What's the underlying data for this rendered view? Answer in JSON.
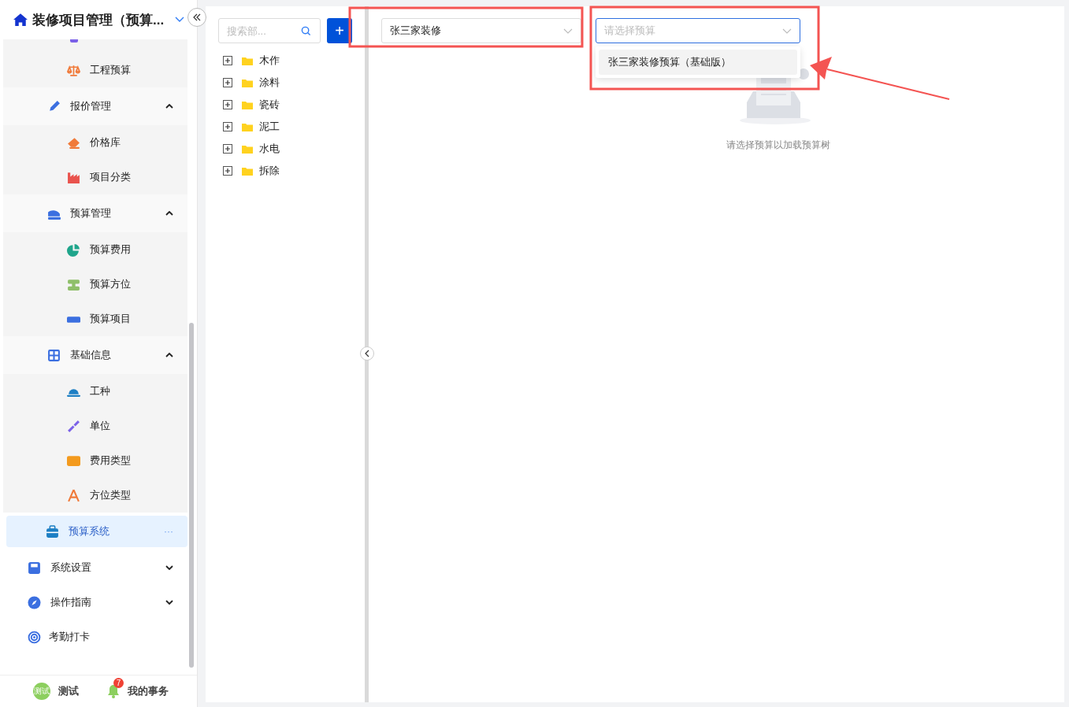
{
  "sidebar": {
    "title": "装修项目管理（预算...",
    "menu": [
      {
        "kind": "group",
        "children": [
          {
            "kind": "group",
            "children": [
              {
                "kind": "item",
                "label": "工程预算",
                "selected": false
              }
            ]
          },
          {
            "kind": "group",
            "label": "报价管理",
            "expanded": true,
            "children": [
              {
                "kind": "item",
                "label": "价格库",
                "selected": false
              },
              {
                "kind": "item",
                "label": "项目分类",
                "selected": false
              }
            ]
          },
          {
            "kind": "group",
            "label": "预算管理",
            "expanded": true,
            "children": [
              {
                "kind": "item",
                "label": "预算费用",
                "selected": false
              },
              {
                "kind": "item",
                "label": "预算方位",
                "selected": false
              },
              {
                "kind": "item",
                "label": "预算项目",
                "selected": false
              }
            ]
          },
          {
            "kind": "group",
            "label": "基础信息",
            "expanded": true,
            "children": [
              {
                "kind": "item",
                "label": "工种",
                "selected": false
              },
              {
                "kind": "item",
                "label": "单位",
                "selected": false
              },
              {
                "kind": "item",
                "label": "费用类型",
                "selected": false
              },
              {
                "kind": "item",
                "label": "方位类型",
                "selected": false
              }
            ]
          },
          {
            "kind": "item",
            "label": "预算系统",
            "selected": true,
            "more": "···"
          }
        ]
      },
      {
        "kind": "group",
        "label": "系统设置",
        "expanded": false
      },
      {
        "kind": "group",
        "label": "操作指南",
        "expanded": false
      },
      {
        "kind": "item",
        "label": "考勤打卡",
        "selected": false
      }
    ],
    "footer": {
      "user": {
        "avatar_text": "测试",
        "name": "测试"
      },
      "tasks": {
        "label": "我的事务",
        "badge": "7"
      }
    }
  },
  "tree_panel": {
    "search": {
      "placeholder": "搜索部..."
    },
    "add_button": "+",
    "items": [
      {
        "label": "木作",
        "expanded": false
      },
      {
        "label": "涂料",
        "expanded": false
      },
      {
        "label": "瓷砖",
        "expanded": false
      },
      {
        "label": "泥工",
        "expanded": false
      },
      {
        "label": "水电",
        "expanded": false
      },
      {
        "label": "拆除",
        "expanded": false
      }
    ]
  },
  "content": {
    "project_select": {
      "value": "张三家装修"
    },
    "budget_select": {
      "placeholder": "请选择预算",
      "open": true,
      "options": [
        {
          "label": "张三家装修预算（基础版）",
          "selected": false
        }
      ]
    },
    "empty_state": {
      "message": "请选择预算以加载预算树"
    }
  }
}
